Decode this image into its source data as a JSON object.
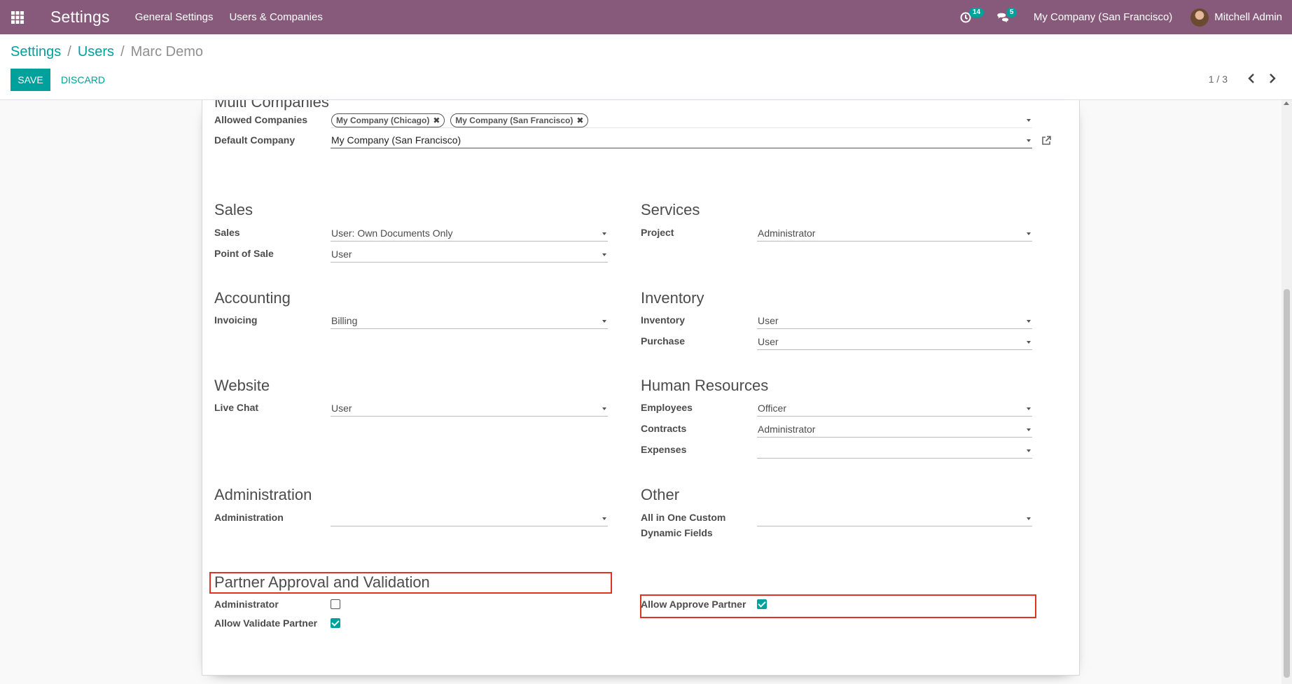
{
  "navbar": {
    "app_title": "Settings",
    "menus": [
      "General Settings",
      "Users & Companies"
    ],
    "activity_count": "14",
    "message_count": "5",
    "company": "My Company (San Francisco)",
    "user": "Mitchell Admin"
  },
  "breadcrumb": {
    "root": "Settings",
    "parent": "Users",
    "current": "Marc Demo",
    "separator": "/"
  },
  "actions": {
    "save": "SAVE",
    "discard": "DISCARD"
  },
  "pager": {
    "value": "1 / 3"
  },
  "multi_companies": {
    "title": "Multi Companies",
    "allowed_label": "Allowed Companies",
    "allowed_tags": [
      "My Company (Chicago)",
      "My Company (San Francisco)"
    ],
    "default_label": "Default Company",
    "default_value": "My Company (San Francisco)"
  },
  "sections": {
    "sales": {
      "title": "Sales",
      "fields": [
        {
          "label": "Sales",
          "value": "User: Own Documents Only"
        },
        {
          "label": "Point of Sale",
          "value": "User"
        }
      ]
    },
    "services": {
      "title": "Services",
      "fields": [
        {
          "label": "Project",
          "value": "Administrator"
        }
      ]
    },
    "accounting": {
      "title": "Accounting",
      "fields": [
        {
          "label": "Invoicing",
          "value": "Billing"
        }
      ]
    },
    "inventory": {
      "title": "Inventory",
      "fields": [
        {
          "label": "Inventory",
          "value": "User"
        },
        {
          "label": "Purchase",
          "value": "User"
        }
      ]
    },
    "website": {
      "title": "Website",
      "fields": [
        {
          "label": "Live Chat",
          "value": "User"
        }
      ]
    },
    "hr": {
      "title": "Human Resources",
      "fields": [
        {
          "label": "Employees",
          "value": "Officer"
        },
        {
          "label": "Contracts",
          "value": "Administrator"
        },
        {
          "label": "Expenses",
          "value": ""
        }
      ]
    },
    "administration": {
      "title": "Administration",
      "fields": [
        {
          "label": "Administration",
          "value": ""
        }
      ]
    },
    "other": {
      "title": "Other",
      "fields": [
        {
          "label": "All in One Custom Dynamic Fields",
          "value": ""
        }
      ]
    },
    "partner": {
      "title": "Partner Approval and Validation",
      "administrator_label": "Administrator",
      "administrator_checked": false,
      "validate_label": "Allow Validate Partner",
      "validate_checked": true,
      "approve_label": "Allow Approve Partner",
      "approve_checked": true
    }
  },
  "colors": {
    "navbar": "#875a7b",
    "accent": "#00a09d",
    "highlight": "#e0341f"
  }
}
